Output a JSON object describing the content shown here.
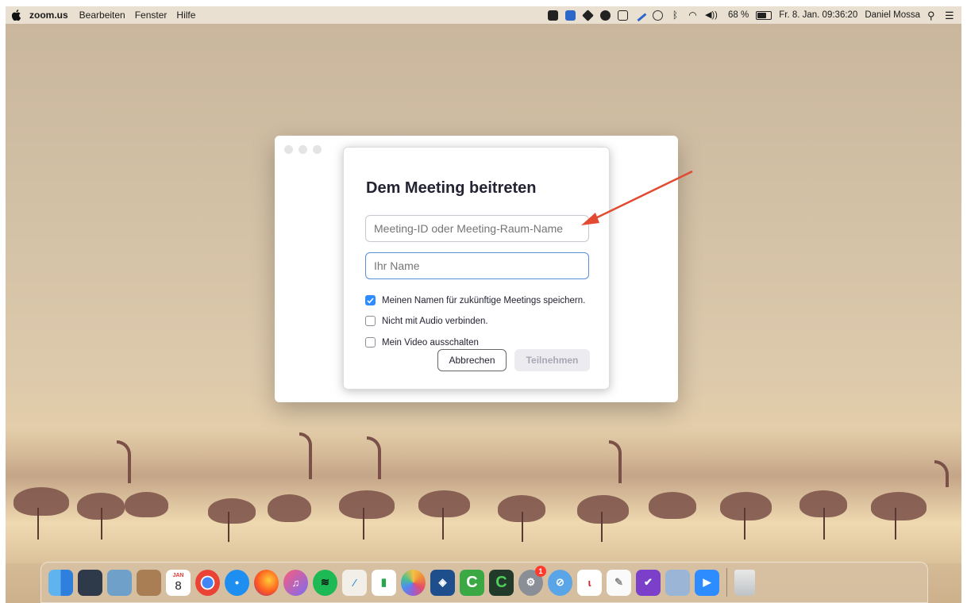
{
  "menubar": {
    "app_name": "zoom.us",
    "menus": [
      "Bearbeiten",
      "Fenster",
      "Hilfe"
    ],
    "battery_percent": "68 %",
    "datetime": "Fr. 8. Jan. 09:36:20",
    "user": "Daniel Mossa"
  },
  "dialog": {
    "title": "Dem Meeting beitreten",
    "meeting_id_placeholder": "Meeting-ID oder Meeting-Raum-Name",
    "name_placeholder": "Ihr Name",
    "checkboxes": [
      {
        "label": "Meinen Namen für zukünftige Meetings speichern.",
        "checked": true
      },
      {
        "label": "Nicht mit Audio verbinden.",
        "checked": false
      },
      {
        "label": "Mein Video ausschalten",
        "checked": false
      }
    ],
    "cancel_label": "Abbrechen",
    "join_label": "Teilnehmen"
  },
  "annotation": {
    "arrow_color": "#e24a32"
  },
  "dock": {
    "calendar_month": "JAN",
    "calendar_day": "8",
    "system_prefs_badge": "1",
    "apps": [
      "finder",
      "mission-control",
      "preview",
      "contacts",
      "calendar",
      "chrome",
      "safari",
      "firefox",
      "music",
      "spotify",
      "pages-pen",
      "numbers",
      "photos",
      "virtualbox",
      "camtasia",
      "camtasia-2",
      "system-preferences",
      "logoff-app",
      "acrobat",
      "textedit",
      "omnifocus",
      "preview-photos",
      "zoom",
      "trash"
    ]
  },
  "colors": {
    "accent": "#2d8cff",
    "focus_border": "#5a8ed6",
    "title": "#232333"
  }
}
